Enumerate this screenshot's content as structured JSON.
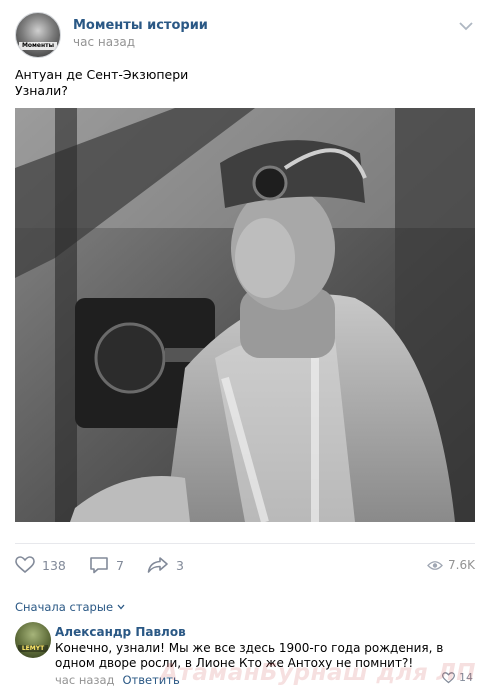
{
  "post": {
    "group_name": "Моменты истории",
    "avatar_caption": "Моменты",
    "time": "час назад",
    "text_line1": "Антуан де Сент-Экзюпери",
    "text_line2": "Узнали?",
    "photo_icon": "black-and-white-photo-pilot-in-cockpit"
  },
  "actions": {
    "likes": "138",
    "comments": "7",
    "shares": "3",
    "views": "7.6K"
  },
  "comments_sort": "Сначала старые",
  "comment": {
    "author": "Александр Павлов",
    "avatar_caption": "LEMYT",
    "text": "Конечно, узнали! Мы же все здесь 1900-го года рождения, в одном дворе росли, в Лионе Кто же Антоху не помнит?!",
    "time": "час назад",
    "reply": "Ответить",
    "likes": "14"
  },
  "watermark": "АтаманБурнаш для ЛП",
  "colors": {
    "link": "#2a5885",
    "muted": "#939393",
    "icon": "#828a99",
    "divider": "#e7e8ec"
  }
}
